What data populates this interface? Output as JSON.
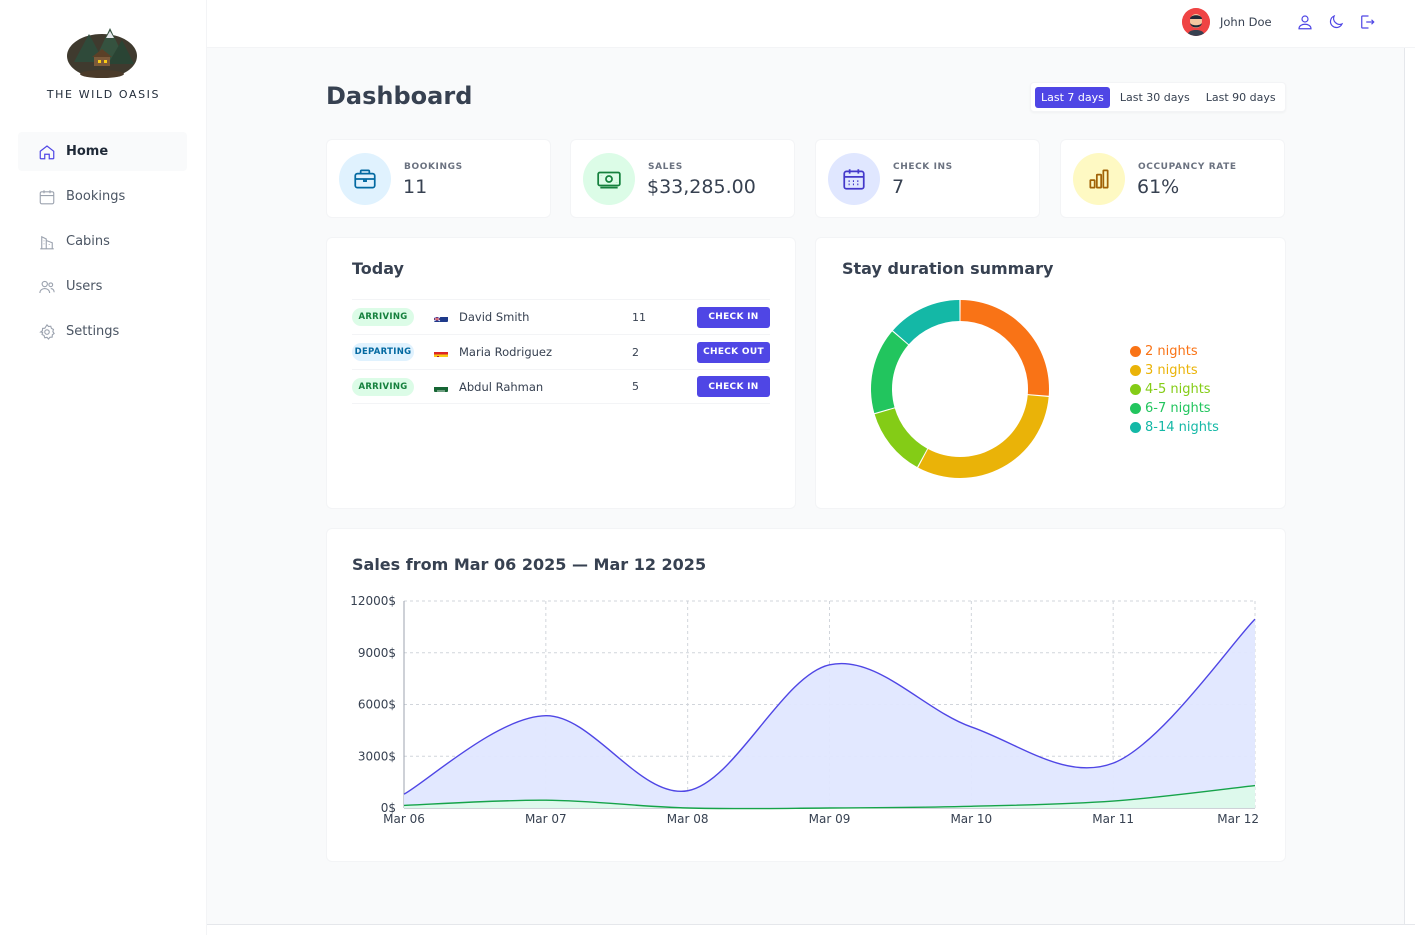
{
  "brand": {
    "name": "THE WILD OASIS"
  },
  "sidebar": {
    "items": [
      {
        "label": "Home",
        "icon": "home-icon",
        "active": true
      },
      {
        "label": "Bookings",
        "icon": "calendar-icon",
        "active": false
      },
      {
        "label": "Cabins",
        "icon": "buildings-icon",
        "active": false
      },
      {
        "label": "Users",
        "icon": "users-icon",
        "active": false
      },
      {
        "label": "Settings",
        "icon": "gear-icon",
        "active": false
      }
    ]
  },
  "header": {
    "user_name": "John Doe",
    "icons": [
      "user-icon",
      "moon-icon",
      "logout-icon"
    ]
  },
  "page": {
    "title": "Dashboard"
  },
  "filter": {
    "options": [
      "Last 7 days",
      "Last 30 days",
      "Last 90 days"
    ],
    "selected": "Last 7 days"
  },
  "stats": [
    {
      "label": "BOOKINGS",
      "value": "11",
      "icon": "briefcase-icon",
      "color": "#0369a1",
      "bg": "#e0f2fe"
    },
    {
      "label": "SALES",
      "value": "$33,285.00",
      "icon": "banknotes-icon",
      "color": "#15803d",
      "bg": "#dcfce7"
    },
    {
      "label": "CHECK INS",
      "value": "7",
      "icon": "calendar-days-icon",
      "color": "#4338ca",
      "bg": "#e0e7ff"
    },
    {
      "label": "OCCUPANCY RATE",
      "value": "61%",
      "icon": "bar-chart-icon",
      "color": "#a16207",
      "bg": "#fef9c3"
    }
  ],
  "today": {
    "title": "Today",
    "rows": [
      {
        "status": "ARRIVING",
        "flag": "au",
        "guest": "David Smith",
        "nights": "11",
        "action": "CHECK IN"
      },
      {
        "status": "DEPARTING",
        "flag": "es",
        "guest": "Maria Rodriguez",
        "nights": "2",
        "action": "CHECK OUT"
      },
      {
        "status": "ARRIVING",
        "flag": "sa",
        "guest": "Abdul Rahman",
        "nights": "5",
        "action": "CHECK IN"
      }
    ]
  },
  "duration": {
    "title": "Stay duration summary",
    "chart_data": {
      "type": "pie",
      "categories": [
        "2 nights",
        "3 nights",
        "4-5 nights",
        "6-7 nights",
        "8-14 nights"
      ],
      "values": [
        25,
        30,
        12,
        15,
        13
      ],
      "colors": [
        "#f97316",
        "#eab308",
        "#84cc16",
        "#22c55e",
        "#14b8a6"
      ],
      "legend_position": "right"
    }
  },
  "sales": {
    "title": "Sales from Mar 06 2025 — Mar 12 2025",
    "chart_data": {
      "type": "area",
      "categories": [
        "Mar 06",
        "Mar 07",
        "Mar 08",
        "Mar 09",
        "Mar 10",
        "Mar 11",
        "Mar 12"
      ],
      "series": [
        {
          "values": [
            800,
            5350,
            1000,
            8300,
            4700,
            2600,
            10950
          ],
          "color": "#4f46e5",
          "fill": "#e0e7ff"
        },
        {
          "values": [
            150,
            450,
            0,
            0,
            100,
            400,
            1300
          ],
          "color": "#16a34a",
          "fill": "#dcfce7"
        }
      ],
      "yticks": [
        "0$",
        "3000$",
        "6000$",
        "9000$",
        "12000$"
      ],
      "ylim": [
        0,
        12000
      ],
      "grid": true
    }
  }
}
